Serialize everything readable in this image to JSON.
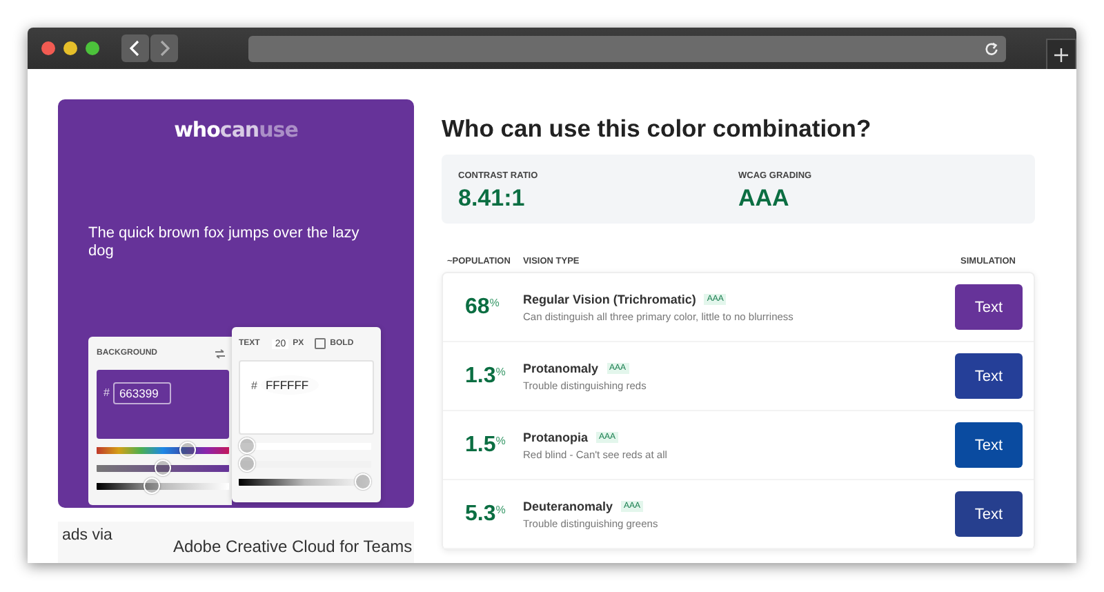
{
  "preview": {
    "logo": [
      "who",
      "can",
      "use"
    ],
    "sample_text": "The quick brown fox jumps over the lazy dog"
  },
  "background_panel": {
    "label": "BACKGROUND",
    "hex_prefix": "#",
    "hex": "663399",
    "color": "#663399",
    "sliders": [
      {
        "kind": "hue",
        "level": 0.72
      },
      {
        "kind": "saturation",
        "level": 0.5
      },
      {
        "kind": "lightness",
        "level": 0.4
      }
    ]
  },
  "text_panel": {
    "label": "TEXT",
    "size": "20",
    "unit": "PX",
    "bold_label": "BOLD",
    "bold": false,
    "hex_prefix": "#",
    "hex": "FFFFFF",
    "color": "#ffffff",
    "sliders": [
      {
        "kind": "hue",
        "level": 0
      },
      {
        "kind": "saturation",
        "level": 0
      },
      {
        "kind": "lightness",
        "level": 1
      }
    ]
  },
  "ads": {
    "label": "ads via",
    "title": "Adobe Creative Cloud for Teams"
  },
  "results": {
    "title": "Who can use this color combination?",
    "stats": [
      {
        "label": "CONTRAST RATIO",
        "value": "8.41:1"
      },
      {
        "label": "WCAG GRADING",
        "value": "AAA"
      }
    ],
    "columns": [
      "~POPULATION",
      "VISION TYPE",
      "SIMULATION"
    ],
    "rows": [
      {
        "population": "68",
        "unit": "%",
        "name": "Regular Vision (Trichromatic)",
        "badge": "AAA",
        "description": "Can distinguish all three primary color, little to no blurriness",
        "button": "Text",
        "color": "#663399"
      },
      {
        "population": "1.3",
        "unit": "%",
        "name": "Protanomaly",
        "badge": "AAA",
        "description": "Trouble distinguishing reds",
        "button": "Text",
        "color": "#253f98"
      },
      {
        "population": "1.5",
        "unit": "%",
        "name": "Protanopia",
        "badge": "AAA",
        "description": "Red blind - Can't see reds at all",
        "button": "Text",
        "color": "#0a4ba0"
      },
      {
        "population": "5.3",
        "unit": "%",
        "name": "Deuteranomaly",
        "badge": "AAA",
        "description": "Trouble distinguishing greens",
        "button": "Text",
        "color": "#263f8e"
      }
    ]
  }
}
